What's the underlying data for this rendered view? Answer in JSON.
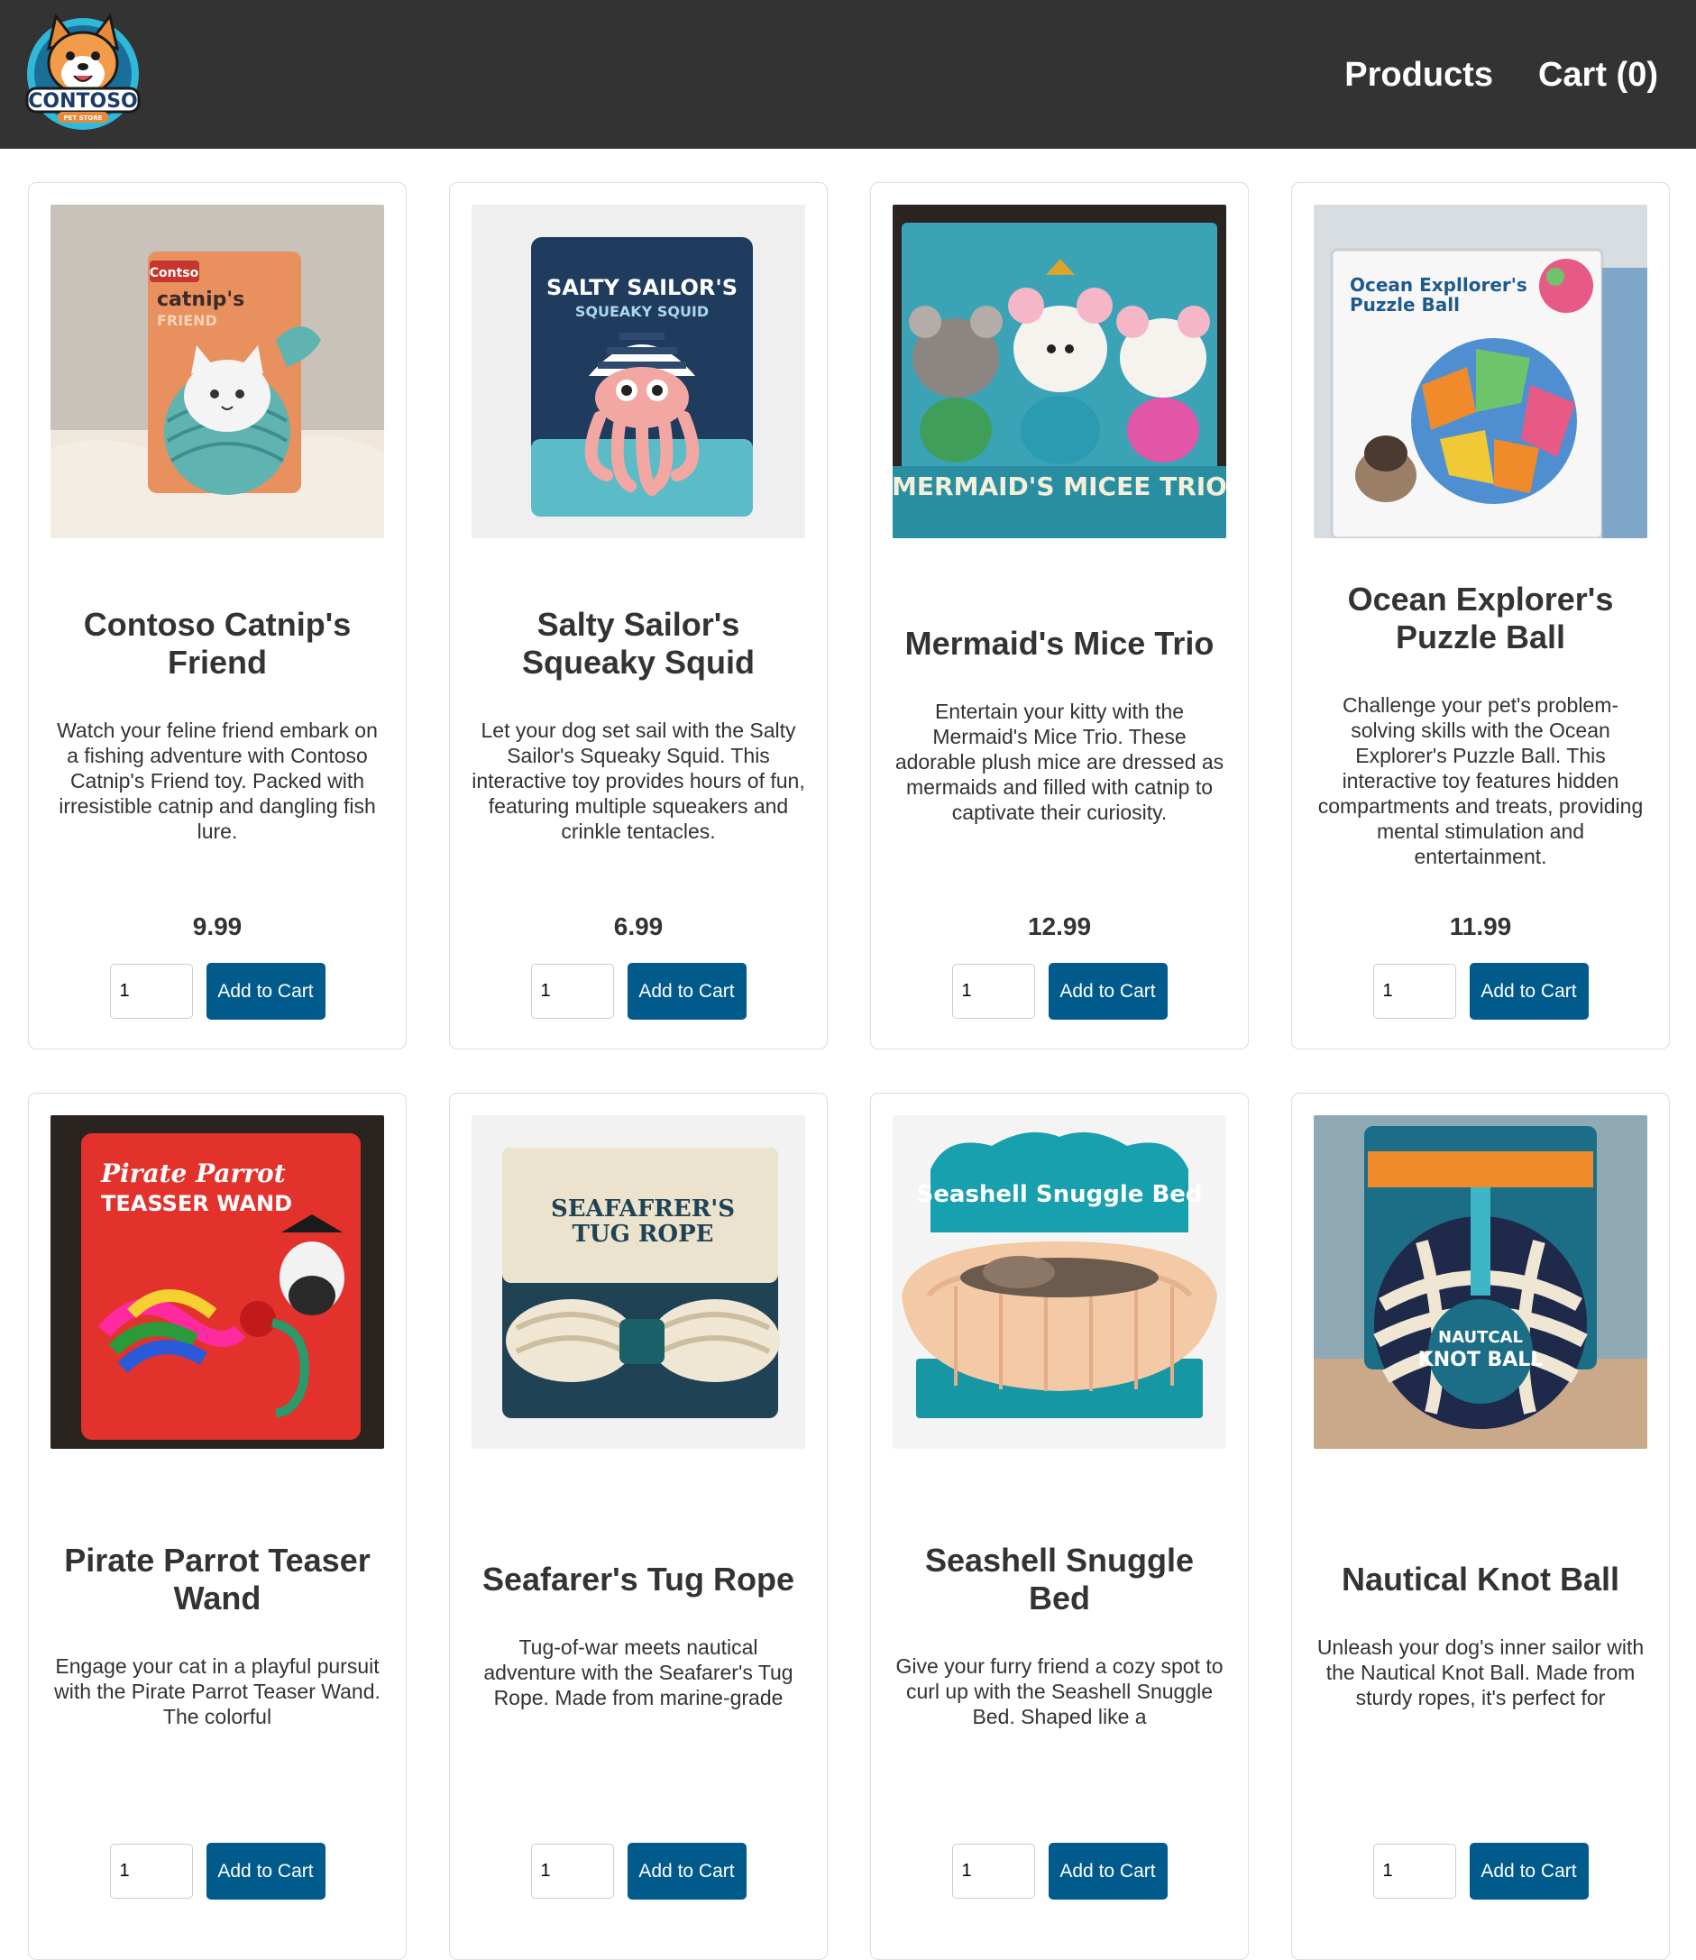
{
  "header": {
    "logo_text": "CONTOSO",
    "logo_subtext": "PET STORE",
    "nav": [
      {
        "label": "Products"
      },
      {
        "label": "Cart (0)"
      }
    ]
  },
  "products": [
    {
      "title": "Contoso Catnip's Friend",
      "description": "Watch your feline friend embark on a fishing adventure with Contoso Catnip's Friend toy. Packed with irresistible catnip and dangling fish lure.",
      "price": "9.99",
      "quantity": "1",
      "button_label": "Add to Cart",
      "image": {
        "package_brand": "Contso",
        "package_title": "catnip's",
        "package_subtitle": "FRIEND"
      }
    },
    {
      "title": "Salty Sailor's Squeaky Squid",
      "description": "Let your dog set sail with the Salty Sailor's Squeaky Squid. This interactive toy provides hours of fun, featuring multiple squeakers and crinkle tentacles.",
      "price": "6.99",
      "quantity": "1",
      "button_label": "Add to Cart",
      "image": {
        "package_title": "SALTY SAILOR'S",
        "package_subtitle": "SQUEAKY SQUID"
      }
    },
    {
      "title": "Mermaid's Mice Trio",
      "description": "Entertain your kitty with the Mermaid's Mice Trio. These adorable plush mice are dressed as mermaids and filled with catnip to captivate their curiosity.",
      "price": "12.99",
      "quantity": "1",
      "button_label": "Add to Cart",
      "image": {
        "package_title": "MERMAID'S MICEE TRIO"
      }
    },
    {
      "title": "Ocean Explorer's Puzzle Ball",
      "description": "Challenge your pet's problem-solving skills with the Ocean Explorer's Puzzle Ball. This interactive toy features hidden compartments and treats, providing mental stimulation and entertainment.",
      "price": "11.99",
      "quantity": "1",
      "button_label": "Add to Cart",
      "image": {
        "package_title": "Ocean Expllorer's",
        "package_subtitle": "Puzzle Ball"
      }
    },
    {
      "title": "Pirate Parrot Teaser Wand",
      "description": "Engage your cat in a playful pursuit with the Pirate Parrot Teaser Wand. The colorful",
      "price": "",
      "quantity": "1",
      "button_label": "Add to Cart",
      "image": {
        "package_title": "Pirate Parrot",
        "package_subtitle": "TEASSER WAND"
      }
    },
    {
      "title": "Seafarer's Tug Rope",
      "description": "Tug-of-war meets nautical adventure with the Seafarer's Tug Rope. Made from marine-grade",
      "price": "",
      "quantity": "1",
      "button_label": "Add to Cart",
      "image": {
        "package_title": "SEAFAFRER'S",
        "package_subtitle": "TUG ROPE"
      }
    },
    {
      "title": "Seashell Snuggle Bed",
      "description": "Give your furry friend a cozy spot to curl up with the Seashell Snuggle Bed. Shaped like a",
      "price": "",
      "quantity": "1",
      "button_label": "Add to Cart",
      "image": {
        "package_title": "Seashell Snuggle Bed"
      }
    },
    {
      "title": "Nautical Knot Ball",
      "description": "Unleash your dog's inner sailor with the Nautical Knot Ball. Made from sturdy ropes, it's perfect for",
      "price": "",
      "quantity": "1",
      "button_label": "Add to Cart",
      "image": {
        "package_title": "NAUTCAL",
        "package_subtitle": "KNOT BALL"
      }
    }
  ],
  "colors": {
    "header_bg": "#333333",
    "button_bg": "#005a8c",
    "card_border": "#dddddd"
  }
}
